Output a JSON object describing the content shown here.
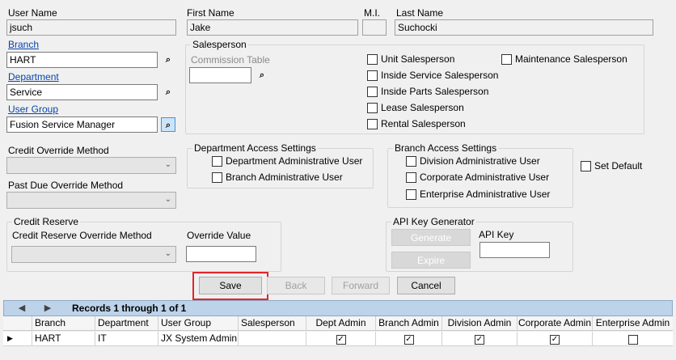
{
  "user": {
    "username_label": "User Name",
    "username_value": "jsuch",
    "first_label": "First Name",
    "first_value": "Jake",
    "mi_label": "M.I.",
    "mi_value": "",
    "last_label": "Last Name",
    "last_value": "Suchocki"
  },
  "branch": {
    "label": "Branch",
    "value": "HART"
  },
  "department": {
    "label": "Department",
    "value": "Service"
  },
  "user_group": {
    "label": "User Group",
    "value": "Fusion Service Manager"
  },
  "icons": {
    "lookup": "binoculars-icon"
  },
  "salesperson": {
    "title": "Salesperson",
    "commission_label": "Commission Table",
    "commission_value": "",
    "checks": [
      {
        "label": "Unit Salesperson",
        "checked": false
      },
      {
        "label": "Inside Service Salesperson",
        "checked": false
      },
      {
        "label": "Inside Parts Salesperson",
        "checked": false
      },
      {
        "label": "Lease Salesperson",
        "checked": false
      },
      {
        "label": "Rental Salesperson",
        "checked": false
      },
      {
        "label": "Maintenance Salesperson",
        "checked": false
      }
    ]
  },
  "credit": {
    "override_label": "Credit Override Method",
    "override_value": "",
    "pastdue_label": "Past Due Override Method",
    "pastdue_value": ""
  },
  "dept_access": {
    "title": "Department Access Settings",
    "checks": [
      {
        "label": "Department Administrative User",
        "checked": false
      },
      {
        "label": "Branch Administrative User",
        "checked": false
      }
    ]
  },
  "branch_access": {
    "title": "Branch Access Settings",
    "checks": [
      {
        "label": "Division Administrative User",
        "checked": false
      },
      {
        "label": "Corporate Administrative User",
        "checked": false
      },
      {
        "label": "Enterprise Administrative User",
        "checked": false
      }
    ]
  },
  "set_default": {
    "label": "Set Default",
    "checked": false
  },
  "credit_reserve": {
    "title": "Credit Reserve",
    "method_label": "Credit Reserve Override Method",
    "method_value": "",
    "value_label": "Override Value",
    "value_value": ""
  },
  "api": {
    "title": "API Key Generator",
    "generate": "Generate",
    "expire": "Expire",
    "key_label": "API Key",
    "key_value": ""
  },
  "actions": {
    "save": "Save",
    "back": "Back",
    "forward": "Forward",
    "cancel": "Cancel"
  },
  "grid": {
    "records_text": "Records 1 through 1 of 1",
    "columns": [
      "Branch",
      "Department",
      "User Group",
      "Salesperson",
      "Dept Admin",
      "Branch Admin",
      "Division Admin",
      "Corporate Admin",
      "Enterprise Admin"
    ],
    "row": {
      "branch": "HART",
      "department": "IT",
      "user_group": "JX System Admin",
      "salesperson": "",
      "dept_admin": true,
      "branch_admin": true,
      "division_admin": true,
      "corporate_admin": true,
      "enterprise_admin": false
    },
    "check_glyph": "✓"
  }
}
